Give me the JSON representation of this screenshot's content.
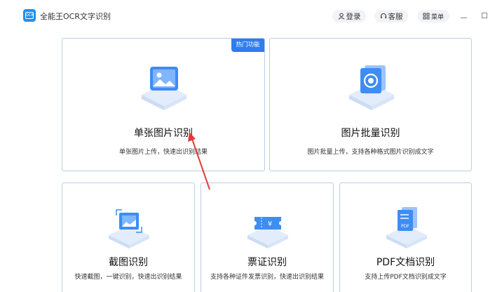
{
  "app": {
    "title": "全能王OCR文字识别",
    "logo_text": "OCR"
  },
  "titlebar": {
    "login_label": "登录",
    "service_label": "客服",
    "menu_label": "菜单"
  },
  "cards": [
    {
      "title": "单张图片识别",
      "desc": "单张图片上传，快速出识别结果",
      "badge": "热门功能",
      "icon": "image-icon"
    },
    {
      "title": "图片批量识别",
      "desc": "图片批量上传，支持各种格式图片识别成文字",
      "icon": "batch-image-icon"
    },
    {
      "title": "截图识别",
      "desc": "快速截图，一键识别，快速出识别结果",
      "icon": "screenshot-icon"
    },
    {
      "title": "票证识别",
      "desc": "支持各种证件发票识别，快速出识别结果",
      "icon": "ticket-icon"
    },
    {
      "title": "PDF文档识别",
      "desc": "支持上传PDF文档识别成文字",
      "icon": "pdf-icon"
    }
  ],
  "colors": {
    "accent": "#2f7cf0",
    "card_border": "#b9cde4",
    "annotation_arrow": "#e23a3a"
  }
}
